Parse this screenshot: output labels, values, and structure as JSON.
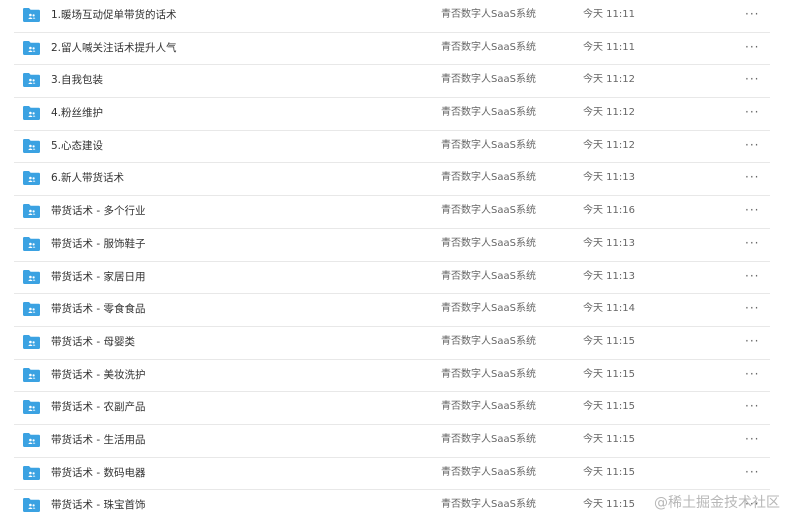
{
  "colors": {
    "folder": "#3BA2E2",
    "divider": "#E8E8E8",
    "text": "#333333",
    "meta_text": "#666666"
  },
  "rows": [
    {
      "name": "1.暖场互动促单带货的话术",
      "owner": "青否数字人SaaS系统",
      "time": "今天 11:11",
      "more": "···"
    },
    {
      "name": "2.留人喊关注话术提升人气",
      "owner": "青否数字人SaaS系统",
      "time": "今天 11:11",
      "more": "···"
    },
    {
      "name": "3.自我包装",
      "owner": "青否数字人SaaS系统",
      "time": "今天 11:12",
      "more": "···"
    },
    {
      "name": "4.粉丝维护",
      "owner": "青否数字人SaaS系统",
      "time": "今天 11:12",
      "more": "···"
    },
    {
      "name": "5.心态建设",
      "owner": "青否数字人SaaS系统",
      "time": "今天 11:12",
      "more": "···"
    },
    {
      "name": "6.新人带货话术",
      "owner": "青否数字人SaaS系统",
      "time": "今天 11:13",
      "more": "···"
    },
    {
      "name": "带货话术 - 多个行业",
      "owner": "青否数字人SaaS系统",
      "time": "今天 11:16",
      "more": "···"
    },
    {
      "name": "带货话术 - 服饰鞋子",
      "owner": "青否数字人SaaS系统",
      "time": "今天 11:13",
      "more": "···"
    },
    {
      "name": "带货话术 - 家居日用",
      "owner": "青否数字人SaaS系统",
      "time": "今天 11:13",
      "more": "···"
    },
    {
      "name": "带货话术 - 零食食品",
      "owner": "青否数字人SaaS系统",
      "time": "今天 11:14",
      "more": "···"
    },
    {
      "name": "带货话术 - 母婴类",
      "owner": "青否数字人SaaS系统",
      "time": "今天 11:15",
      "more": "···"
    },
    {
      "name": "带货话术 - 美妆洗护",
      "owner": "青否数字人SaaS系统",
      "time": "今天 11:15",
      "more": "···"
    },
    {
      "name": "带货话术 - 农副产品",
      "owner": "青否数字人SaaS系统",
      "time": "今天 11:15",
      "more": "···"
    },
    {
      "name": "带货话术 - 生活用品",
      "owner": "青否数字人SaaS系统",
      "time": "今天 11:15",
      "more": "···"
    },
    {
      "name": "带货话术 - 数码电器",
      "owner": "青否数字人SaaS系统",
      "time": "今天 11:15",
      "more": "···"
    },
    {
      "name": "带货话术 - 珠宝首饰",
      "owner": "青否数字人SaaS系统",
      "time": "今天 11:15",
      "more": "···"
    }
  ],
  "watermark": "@稀土掘金技术社区"
}
